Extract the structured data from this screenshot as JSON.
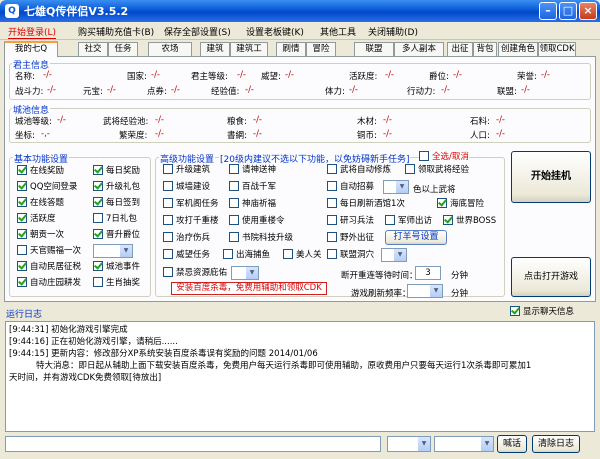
{
  "window": {
    "title": "七雄Q传伴侣V3.5.2",
    "icon_text": "Q"
  },
  "menu": [
    "开始登录(L)",
    "购买辅助充值卡(B)",
    "保存全部设置(S)",
    "设置老板键(K)",
    "其他工具",
    "关闭辅助(D)"
  ],
  "tabs": [
    "我的七Q",
    "社交",
    "任务",
    "农场",
    "建筑",
    "建筑工",
    "刷情",
    "冒险",
    "联盟",
    "多人副本",
    "出征",
    "背包",
    "创建角色",
    "领取CDK"
  ],
  "lord": {
    "title": "君主信息",
    "row1": [
      {
        "label": "名称:",
        "value": "-/-"
      },
      {
        "label": "国家:",
        "value": "-/-"
      },
      {
        "label": "君主等级:",
        "value": "-/-"
      },
      {
        "label": "威望:",
        "value": "-/-"
      },
      {
        "label": "活跃度:",
        "value": "-/-"
      },
      {
        "label": "爵位:",
        "value": "-/-"
      },
      {
        "label": "荣誉:",
        "value": "-/-"
      }
    ],
    "row2": [
      {
        "label": "战斗力:",
        "value": "-/-"
      },
      {
        "label": "元宝:",
        "value": "-/-"
      },
      {
        "label": "点券:",
        "value": "-/-"
      },
      {
        "label": "经验值:",
        "value": "-/-"
      },
      {
        "label": "体力:",
        "value": "-/-"
      },
      {
        "label": "行动力:",
        "value": "-/-"
      },
      {
        "label": "联盟:",
        "value": "-/-"
      }
    ]
  },
  "city": {
    "title": "城池信息",
    "row1": [
      {
        "label": "城池等级:",
        "value": "-/-"
      },
      {
        "label": "武将经验池:",
        "value": "-/-"
      },
      {
        "label": "粮食:",
        "value": "-/-"
      },
      {
        "label": "木材:",
        "value": "-/-"
      },
      {
        "label": "石料:",
        "value": "-/-"
      }
    ],
    "row2": [
      {
        "label": "坐标:",
        "value": "-,-"
      },
      {
        "label": "繁荣度:",
        "value": "-/-"
      },
      {
        "label": "書網:",
        "value": "-/-"
      },
      {
        "label": "铜币:",
        "value": "-/-"
      },
      {
        "label": "人口:",
        "value": "-/-"
      }
    ]
  },
  "basic": {
    "title": "基本功能设置",
    "items": [
      {
        "label": "在线奖励",
        "checked": true
      },
      {
        "label": "每日奖励",
        "checked": true
      },
      {
        "label": "QQ空间登录",
        "checked": true
      },
      {
        "label": "升级礼包",
        "checked": true
      },
      {
        "label": "在线答题",
        "checked": true
      },
      {
        "label": "每日签到",
        "checked": true
      },
      {
        "label": "活跃度",
        "checked": true
      },
      {
        "label": "7日礼包",
        "checked": false
      },
      {
        "label": "朝贡一次",
        "checked": true
      },
      {
        "label": "晋升爵位",
        "checked": true
      },
      {
        "label": "天官赐福一次",
        "checked": false
      },
      {
        "label": "自动民居征税",
        "checked": true
      },
      {
        "label": "城池事件",
        "checked": true
      },
      {
        "label": "自动庄园耕发",
        "checked": true
      },
      {
        "label": "生肖抽奖",
        "checked": false
      }
    ]
  },
  "advanced": {
    "title": "高级功能设置",
    "hint": "[20级内建议不选以下功能，以免妨碍新手任务]",
    "select_all": "全选/取消",
    "items": [
      {
        "label": "升级建筑",
        "checked": false
      },
      {
        "label": "请神送神",
        "checked": false
      },
      {
        "label": "武将自动修炼",
        "checked": false
      },
      {
        "label": "领取武将经验",
        "checked": false
      },
      {
        "label": "城墙建设",
        "checked": false
      },
      {
        "label": "百战千军",
        "checked": false
      },
      {
        "label": "自动招募",
        "checked": false
      },
      {
        "label": "色以上武将",
        "checked": null
      },
      {
        "label": "军机阁任务",
        "checked": false
      },
      {
        "label": "神庙祈福",
        "checked": false
      },
      {
        "label": "每日刷新酒馆1次",
        "checked": false
      },
      {
        "label": "海底冒险",
        "checked": true
      },
      {
        "label": "攻打千重楼",
        "checked": false
      },
      {
        "label": "使用重楼令",
        "checked": false
      },
      {
        "label": "研习兵法",
        "checked": false
      },
      {
        "label": "军师出访",
        "checked": false
      },
      {
        "label": "世界BOSS",
        "checked": true
      },
      {
        "label": "治疗伤兵",
        "checked": false
      },
      {
        "label": "书院科技升级",
        "checked": false
      },
      {
        "label": "野外出征",
        "checked": false
      },
      {
        "label": "威望任务",
        "checked": false
      },
      {
        "label": "出海捕鱼",
        "checked": false
      },
      {
        "label": "美人关",
        "checked": false
      },
      {
        "label": "联盟洞穴",
        "checked": false
      },
      {
        "label": "禁忌资源庇佑",
        "checked": false
      }
    ],
    "account_button": "打羊号设置",
    "reconnect_label": "断开重连等待时间：",
    "reconnect_value": "3",
    "reconnect_unit": "分钟",
    "refresh_label": "游戏刷新频率：",
    "refresh_unit": "分钟",
    "notice_button": "安装百度杀毒，免费用辅助和领取CDK"
  },
  "actions": {
    "start": "开始挂机",
    "open_game": "点击打开游戏"
  },
  "log": {
    "title": "运行日志",
    "show_chat": "显示聊天信息",
    "show_chat_checked": true,
    "lines": [
      "[9:44:31] 初始化游戏引擎完成",
      "[9:44:16] 正在初始化游戏引擎，请稍后......",
      "[9:44:15] 更新内容：修改部分XP系统安装百度杀毒误有奖励的问题 2014/01/06",
      "          特大消息：即日起从辅助上面下载安装百度杀毒，免费用户每天运行杀毒即可使用辅助，原收费用户只要每天运行1次杀毒即可累加1",
      "天时间，并有游戏CDK免费领取[待放出]"
    ]
  },
  "bottom": {
    "shout": "喊话",
    "clear_log": "清除日志"
  }
}
